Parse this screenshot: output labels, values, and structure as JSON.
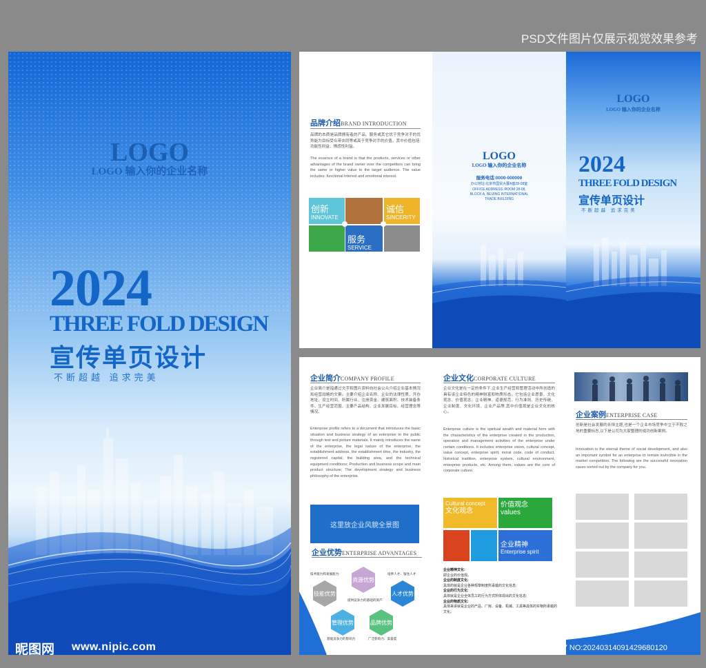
{
  "caption": "PSD文件图片仅展示视觉效果参考",
  "cover": {
    "logo": "LOGO",
    "company": "LOGO 输入你的企业名称",
    "year": "2024",
    "design_en": "THREE FOLD DESIGN",
    "design_cn": "宣传单页设计",
    "slogan": "不断超越  追求完美"
  },
  "watermark": {
    "logo": "昵图网",
    "url": "www.nipic.com",
    "id_line": "ID:6237737 NO:20240314091429680120"
  },
  "outside": {
    "brand": {
      "title_cn": "品牌介绍",
      "title_en": "BRAND INTRODUCTION",
      "text_cn": "品牌的本质是品牌拥有者的产品、服务或其它优于竞争对手的优势能为目标受众带去同等或高于竞争对手的价值。其中价值包括:功能性利益、情感性利益。",
      "text_en": "The essence of a brand is that the products, services or other advantages of the brand owner over the competitors can bring the same or higher value to the target audience. The value includes: functional interest and emotional interest.",
      "tiles": [
        {
          "cn": "创新",
          "en": "INNOVATE",
          "color": "#5ec6d8"
        },
        {
          "cn": "",
          "en": "",
          "color": "#b0733d"
        },
        {
          "cn": "诚信",
          "en": "SINCERITY",
          "color": "#efb42a"
        },
        {
          "cn": "",
          "en": "",
          "color": "#3da84a"
        },
        {
          "cn": "服务",
          "en": "SERVICE",
          "color": "#2a6fc4"
        },
        {
          "cn": "",
          "en": "",
          "color": "#8c8c8c"
        }
      ]
    },
    "back": {
      "logo": "LOGO",
      "company": "LOGO 输入你的企业名称",
      "phone": "服务电话:0000-000000",
      "address_cn": "办公地址:北京市国贸大厦A座28-08室",
      "address_en_1": "OFFICE ADDRESS: ROOM 28-08,",
      "address_en_2": "BLOCK A, BEIJING INTERNATIONAL",
      "address_en_3": "TRADE BUILDING"
    },
    "front": {
      "logo": "LOGO",
      "company": "LOGO 输入你的企业名称",
      "year": "2024",
      "design_en": "THREE FOLD DESIGN",
      "design_cn": "宣传单页设计",
      "slogan": "不断超越  追求完美"
    }
  },
  "inside": {
    "profile": {
      "title_cn": "企业简介",
      "title_en": "COMPANY PROFILE",
      "text_cn": "企业简介是指通过文字和图片资料向社会公众介绍企业基本情况和经营战略的文案。主要介绍企业名称、企业的法律性质、开办地址、设立时间、所属行业、注册资金、建筑面积、技术装备条件、生产经营范围、主要产品结构、企业发展目标、经营理念等情况。",
      "text_en": "Enterprise profile refers to a document that introduces the basic situation and business strategy of an enterprise to the public through text and picture materials. It mainly introduces the name of the enterprise, the legal nature of the enterprise, the establishment address, the establishment time, the industry, the registered capital, the building area, and the technical equipment conditions; Production and business scope and main product structure; The development strategy and business philosophy of the enterprise.",
      "panorama": "这里放企业风貌全景图"
    },
    "advantages": {
      "title_cn": "企业优势",
      "title_en": "ENTERPRISE ADVANTAGES",
      "hexes": [
        {
          "label": "技能优势",
          "color": "#a7a7a7"
        },
        {
          "label": "资源优势",
          "color": "#c7a6d4"
        },
        {
          "label": "人才优势",
          "color": "#2b86d8"
        },
        {
          "label": "管理优势",
          "color": "#4cb0e0"
        },
        {
          "label": "品牌优势",
          "color": "#5ac27f"
        }
      ],
      "notes": [
        "技术能力和发展能力",
        "培养人才、留住人才",
        "提供竞争力的基础的资产",
        "基础竞争力的影响力",
        "广泛影响力、美誉度"
      ]
    },
    "culture": {
      "title_cn": "企业文化",
      "title_en": "CORPORATE CULTURE",
      "text_cn": "企业文化是在一定的条件下,企业生产经营和管理活动中所创造的具有该企业特色的精神财富和物质形态。它包括企业愿景、文化观念、价值观念、企业精神、道德规范、行为准则、历史传统、企业制度、文化环境、企业产品等,其中价值观是企业文化的核心。",
      "text_en": "Enterprise culture is the spiritual wealth and material form with the characteristics of the enterprise created in the production, operation and management activities of the enterprise under certain conditions. It includes enterprise vision, cultural concept, value concept, enterprise spirit, moral code, code of conduct, historical tradition, enterprise system, cultural environment, enterprise products, etc. Among them, values are the core of corporate culture.",
      "tiles": [
        {
          "l1": "Cultural concept",
          "l2": "文化观念",
          "color": "#f0ba2b"
        },
        {
          "l1": "价值观念",
          "l2": "values",
          "color": "#2aa83b"
        },
        {
          "l1": "",
          "l2": "",
          "color": "#d9441e"
        },
        {
          "l1": "",
          "l2": "",
          "color": "#1f9be0"
        },
        {
          "l1": "企业精神",
          "l2": "Enterprise spirit",
          "color": "#2c6fd9"
        }
      ],
      "list": [
        {
          "text": "企业精神文化:",
          "bold": true
        },
        {
          "text": "即企业的价值观。",
          "bold": false
        },
        {
          "text": "企业的制度文化:",
          "bold": true
        },
        {
          "text": "具体的就是企业各种规章制度所承载的文化信息;",
          "bold": false
        },
        {
          "text": "企业的行为文化:",
          "bold": true
        },
        {
          "text": "具体就是企业全体员工的行为方式所体现出的文化信息;",
          "bold": false
        },
        {
          "text": "企业的物质文化:",
          "bold": true
        },
        {
          "text": "具体来讲就是企业的产品、厂房、设备、机械、工具等具体的实物所承载的文化。",
          "bold": false
        }
      ]
    },
    "cases": {
      "title_cn": "企业案例",
      "title_en": "ENTERPRISE CASE",
      "text_cn": "创新是社会发展的永恒主题,也是一个企业市场竞争中立于不败之地的重要标志,以下是公司为大家整理的成功创新案例。",
      "text_en": "Innovation is the eternal theme of social development, and also an important symbol for an enterprise to remain invincible in the market competition. The following are the successful innovation cases sorted out by the company for you."
    }
  }
}
